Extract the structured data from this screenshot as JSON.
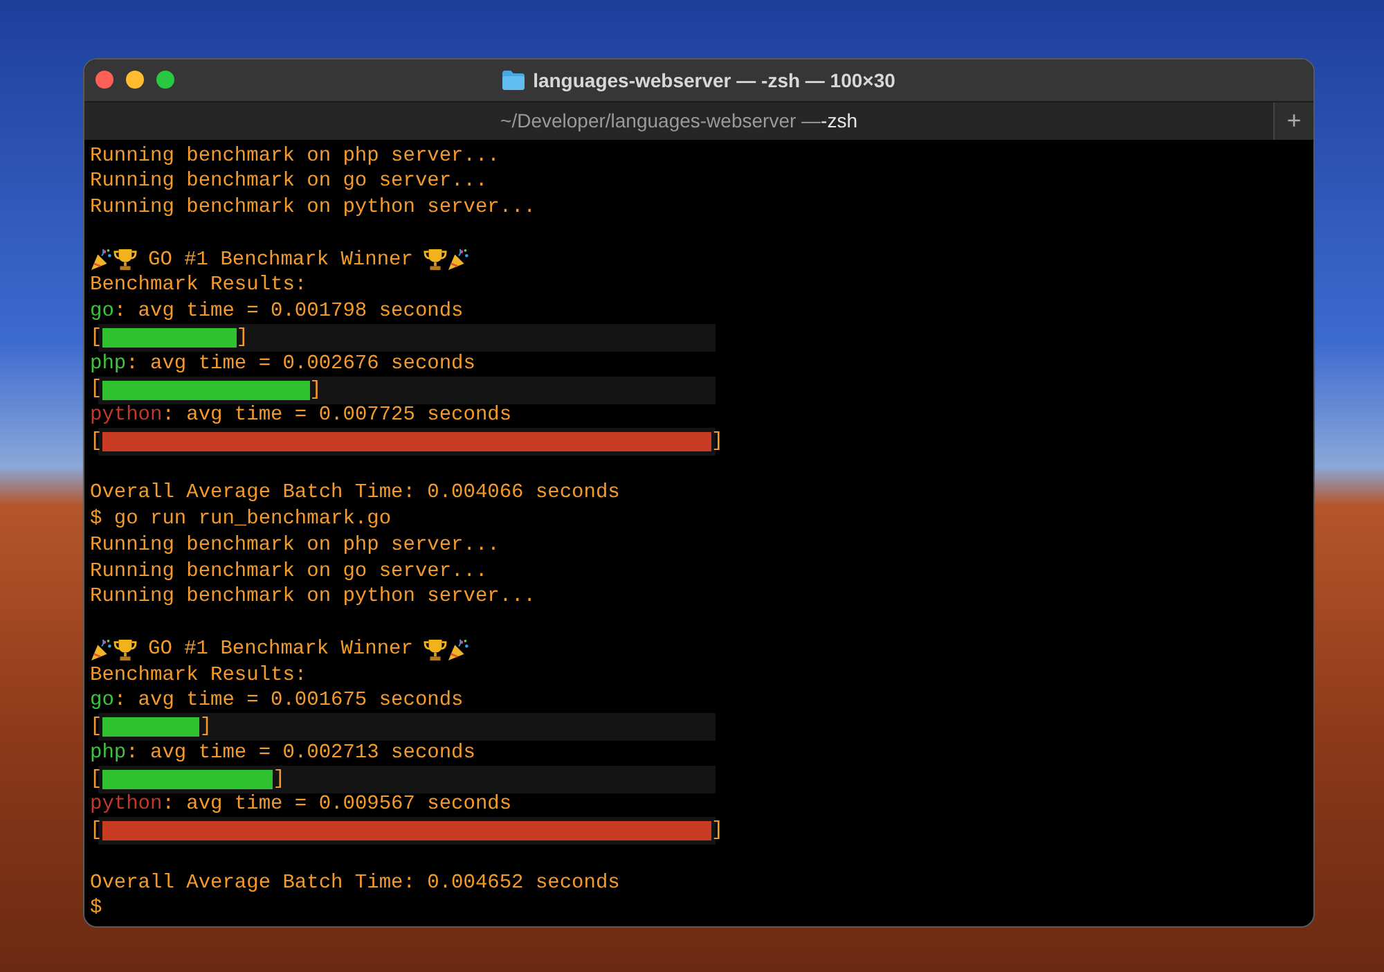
{
  "window": {
    "title": "languages-webserver — -zsh — 100×30"
  },
  "tab": {
    "path": "~/Developer/languages-webserver — ",
    "shell": "-zsh",
    "new_tab": "+"
  },
  "lines": [
    {
      "kind": "text",
      "text": "Running benchmark on php server..."
    },
    {
      "kind": "text",
      "text": "Running benchmark on go server..."
    },
    {
      "kind": "text",
      "text": "Running benchmark on python server..."
    },
    {
      "kind": "blank"
    },
    {
      "kind": "winner",
      "text": "GO #1 Benchmark Winner"
    },
    {
      "kind": "text",
      "text": "Benchmark Results:"
    },
    {
      "kind": "result",
      "lang": "go",
      "text": ": avg time = 0.001798 seconds",
      "color": "#3cc43c"
    },
    {
      "kind": "bar",
      "open": "[",
      "close": "]",
      "level": 0.22,
      "color": "#2fc12f"
    },
    {
      "kind": "result",
      "lang": "php",
      "text": ": avg time = 0.002676 seconds",
      "color": "#3cc43c"
    },
    {
      "kind": "bar",
      "open": "[",
      "close": "]",
      "level": 0.34,
      "color": "#2fc12f"
    },
    {
      "kind": "result",
      "lang": "python",
      "text": ": avg time = 0.007725 seconds",
      "color": "#c0392b"
    },
    {
      "kind": "bar",
      "open": "[",
      "close": "]",
      "level": 1.0,
      "color": "#c93c24"
    },
    {
      "kind": "blank"
    },
    {
      "kind": "text",
      "text": "Overall Average Batch Time: 0.004066 seconds"
    },
    {
      "kind": "prompt",
      "text": "$ go run run_benchmark.go"
    },
    {
      "kind": "text",
      "text": "Running benchmark on php server..."
    },
    {
      "kind": "text",
      "text": "Running benchmark on go server..."
    },
    {
      "kind": "text",
      "text": "Running benchmark on python server..."
    },
    {
      "kind": "blank"
    },
    {
      "kind": "winner",
      "text": "GO #1 Benchmark Winner"
    },
    {
      "kind": "text",
      "text": "Benchmark Results:"
    },
    {
      "kind": "result",
      "lang": "go",
      "text": ": avg time = 0.001675 seconds",
      "color": "#3cc43c"
    },
    {
      "kind": "bar",
      "open": "[",
      "close": "]",
      "level": 0.16,
      "color": "#2fc12f"
    },
    {
      "kind": "result",
      "lang": "php",
      "text": ": avg time = 0.002713 seconds",
      "color": "#3cc43c"
    },
    {
      "kind": "bar",
      "open": "[",
      "close": "]",
      "level": 0.28,
      "color": "#2fc12f"
    },
    {
      "kind": "result",
      "lang": "python",
      "text": ": avg time = 0.009567 seconds",
      "color": "#c0392b"
    },
    {
      "kind": "bar",
      "open": "[",
      "close": "]",
      "level": 1.0,
      "color": "#c93c24"
    },
    {
      "kind": "blank"
    },
    {
      "kind": "text",
      "text": "Overall Average Batch Time: 0.004652 seconds"
    },
    {
      "kind": "prompt",
      "text": "$"
    }
  ]
}
